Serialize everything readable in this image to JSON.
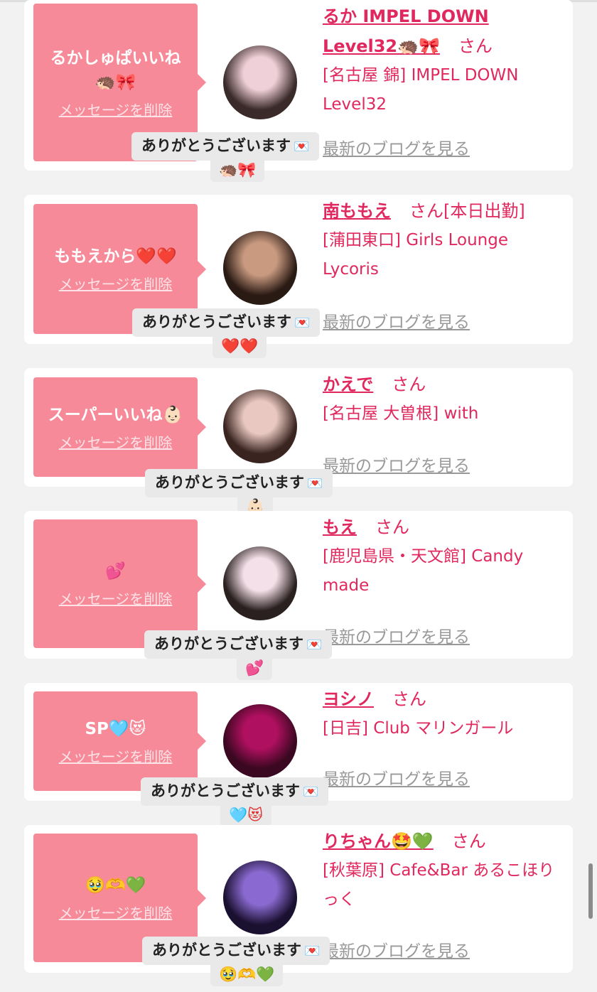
{
  "messages": [
    {
      "bubble_text": "るかしゅぱいいね\n🦔🎀",
      "delete_label": "メッセージを削除",
      "name": "るか IMPEL DOWN Level32🦔🎀",
      "honorific": "さん",
      "status": "",
      "shop": "[名古屋 錦] IMPEL DOWN Level32",
      "blog_label": "最新のブログを見る",
      "reply_text": "ありがとうございます",
      "reply_emoji": "🦔🎀",
      "avatar_colors": [
        "#f0d0d8",
        "#3a2a2a"
      ]
    },
    {
      "bubble_text": "ももえから❤️❤️",
      "delete_label": "メッセージを削除",
      "name": "南ももえ",
      "honorific": "さん",
      "status": "[本日出勤]",
      "shop": "[蒲田東口] Girls Lounge Lycoris",
      "blog_label": "最新のブログを見る",
      "reply_text": "ありがとうございます",
      "reply_emoji": "❤️❤️",
      "avatar_colors": [
        "#c99a80",
        "#2a1a14"
      ]
    },
    {
      "bubble_text": "スーパーいいね👶🏻",
      "delete_label": "メッセージを削除",
      "name": "かえで",
      "honorific": "さん",
      "status": "",
      "shop": "[名古屋 大曽根] with",
      "blog_label": "最新のブログを見る",
      "reply_text": "ありがとうございます",
      "reply_emoji": "👶🏻",
      "avatar_colors": [
        "#e8c8c0",
        "#3a2420"
      ]
    },
    {
      "bubble_text": "💕",
      "delete_label": "メッセージを削除",
      "name": "もえ",
      "honorific": "さん",
      "status": "",
      "shop": "[鹿児島県・天文館] Candy made",
      "blog_label": "最新のブログを見る",
      "reply_text": "ありがとうございます",
      "reply_emoji": "💕",
      "avatar_colors": [
        "#f4e0e8",
        "#2a2020"
      ]
    },
    {
      "bubble_text": "SP🩵😻",
      "delete_label": "メッセージを削除",
      "name": "ヨシノ",
      "honorific": "さん",
      "status": "",
      "shop": "[日吉] Club マリンガール",
      "blog_label": "最新のブログを見る",
      "reply_text": "ありがとうございます",
      "reply_emoji": "🩵😻",
      "avatar_colors": [
        "#b01060",
        "#3a0820"
      ]
    },
    {
      "bubble_text": "🥹🫶💚",
      "delete_label": "メッセージを削除",
      "name": "りちゃん🤩💚",
      "honorific": "さん",
      "status": "",
      "shop": "[秋葉原] Cafe&Bar あるこほりっく",
      "blog_label": "最新のブログを見る",
      "reply_text": "ありがとうございます",
      "reply_emoji": "🥹🫶💚",
      "avatar_colors": [
        "#8a6ad0",
        "#1a1030"
      ]
    }
  ]
}
